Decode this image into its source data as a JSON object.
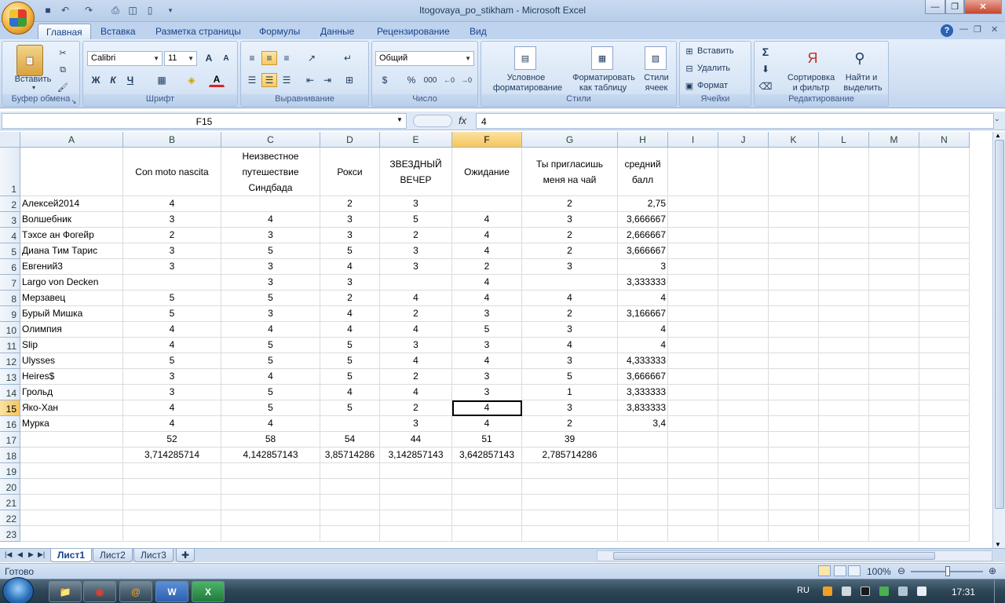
{
  "window": {
    "title": "Itogovaya_po_stikham - Microsoft Excel"
  },
  "ribbon_tabs": [
    "Главная",
    "Вставка",
    "Разметка страницы",
    "Формулы",
    "Данные",
    "Рецензирование",
    "Вид"
  ],
  "ribbon": {
    "clipboard": {
      "paste": "Вставить",
      "group": "Буфер обмена"
    },
    "font": {
      "name": "Calibri",
      "size": "11",
      "bold": "Ж",
      "italic": "К",
      "underline": "Ч",
      "grow": "A",
      "shrink": "A",
      "color_letter": "A",
      "group": "Шрифт"
    },
    "alignment": {
      "group": "Выравнивание"
    },
    "number": {
      "format": "Общий",
      "percent": "%",
      "thousands": "000",
      "group": "Число"
    },
    "styles": {
      "conditional1": "Условное",
      "conditional2": "форматирование",
      "table1": "Форматировать",
      "table2": "как таблицу",
      "cell1": "Стили",
      "cell2": "ячеек",
      "group": "Стили"
    },
    "cells": {
      "insert": "Вставить",
      "delete": "Удалить",
      "format": "Формат",
      "group": "Ячейки"
    },
    "editing": {
      "sum": "Σ",
      "sort1": "Сортировка",
      "sort2": "и фильтр",
      "find1": "Найти и",
      "find2": "выделить",
      "group": "Редактирование"
    }
  },
  "formula_bar": {
    "name_box": "F15",
    "fx": "fx",
    "content": "4"
  },
  "columns": [
    "A",
    "B",
    "C",
    "D",
    "E",
    "F",
    "G",
    "H",
    "I",
    "J",
    "K",
    "L",
    "M",
    "N"
  ],
  "rows": [
    [
      "",
      "Con moto nascita",
      "Неизвестное путешествие Синдбада",
      "Рокси",
      "ЗВЕЗДНЫЙ ВЕЧЕР",
      "Ожидание",
      "Ты пригласишь меня на чай",
      "средний балл"
    ],
    [
      "Алексей2014",
      "4",
      "",
      "2",
      "3",
      "",
      "2",
      "2,75"
    ],
    [
      "Волшебник",
      "3",
      "4",
      "3",
      "5",
      "4",
      "3",
      "3,666667"
    ],
    [
      "Тэхсе ан Фогейр",
      "2",
      "3",
      "3",
      "2",
      "4",
      "2",
      "2,666667"
    ],
    [
      "Диана Тим Тарис",
      "3",
      "5",
      "5",
      "3",
      "4",
      "2",
      "3,666667"
    ],
    [
      "Евгений3",
      "3",
      "3",
      "4",
      "3",
      "2",
      "3",
      "3"
    ],
    [
      "Largo von Decken",
      "",
      "3",
      "3",
      "",
      "4",
      "",
      "3,333333"
    ],
    [
      "Мерзавец",
      "5",
      "5",
      "2",
      "4",
      "4",
      "4",
      "4"
    ],
    [
      "Бурый Мишка",
      "5",
      "3",
      "4",
      "2",
      "3",
      "2",
      "3,166667"
    ],
    [
      "Олимпия",
      "4",
      "4",
      "4",
      "4",
      "5",
      "3",
      "4"
    ],
    [
      "Slip",
      "4",
      "5",
      "5",
      "3",
      "3",
      "4",
      "4"
    ],
    [
      "Ulysses",
      "5",
      "5",
      "5",
      "4",
      "4",
      "3",
      "4,333333"
    ],
    [
      "Heires$",
      "3",
      "4",
      "5",
      "2",
      "3",
      "5",
      "3,666667"
    ],
    [
      "Грольд",
      "3",
      "5",
      "4",
      "4",
      "3",
      "1",
      "3,333333"
    ],
    [
      "Яко-Хан",
      "4",
      "5",
      "5",
      "2",
      "4",
      "3",
      "3,833333"
    ],
    [
      "Мурка",
      "4",
      "4",
      "",
      "3",
      "4",
      "2",
      "3,4"
    ],
    [
      "",
      "52",
      "58",
      "54",
      "44",
      "51",
      "39",
      ""
    ],
    [
      "",
      "3,714285714",
      "4,142857143",
      "3,85714286",
      "3,142857143",
      "3,642857143",
      "2,785714286",
      ""
    ],
    [
      "",
      "",
      "",
      "",
      "",
      "",
      "",
      ""
    ],
    [
      "",
      "",
      "",
      "",
      "",
      "",
      "",
      ""
    ],
    [
      "",
      "",
      "",
      "",
      "",
      "",
      "",
      ""
    ],
    [
      "",
      "",
      "",
      "",
      "",
      "",
      "",
      ""
    ],
    [
      "",
      "",
      "",
      "",
      "",
      "",
      "",
      ""
    ]
  ],
  "selected_cell": "F15",
  "sheets": [
    "Лист1",
    "Лист2",
    "Лист3"
  ],
  "status": {
    "ready": "Готово",
    "zoom": "100%"
  },
  "taskbar": {
    "lang": "RU",
    "time": "17:31"
  }
}
